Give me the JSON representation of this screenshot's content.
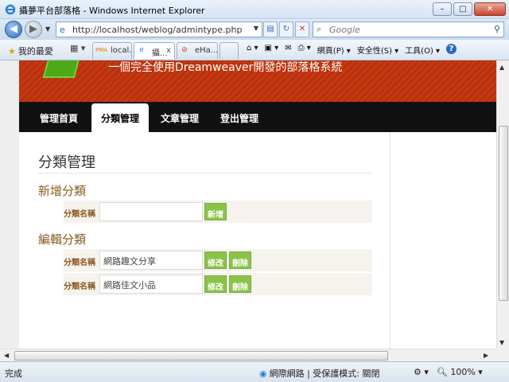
{
  "window": {
    "title": "攝夢平台部落格 - Windows Internet Explorer",
    "buttons": {
      "minimize": "–",
      "maximize": "□",
      "close": "✕"
    }
  },
  "address": {
    "url": "http://localhost/weblog/admintype.php",
    "search_placeholder": "Google"
  },
  "toolbar": {
    "favorites_label": "我的最愛",
    "tabs": [
      {
        "label": "local...",
        "icon": "pma-icon"
      },
      {
        "label": "攝...",
        "icon": "ie-page-icon",
        "close": "x"
      },
      {
        "label": "eHa...",
        "icon": "ehappy-icon"
      }
    ],
    "commands": [
      "網頁(P) ▾",
      "安全性(S) ▾",
      "工具(O) ▾",
      "?"
    ]
  },
  "site": {
    "slogan": "一個完全使用Dreamweaver開發的部落格系統",
    "nav": [
      {
        "label": "管理首頁",
        "active": false
      },
      {
        "label": "分類管理",
        "active": true
      },
      {
        "label": "文章管理",
        "active": false
      },
      {
        "label": "登出管理",
        "active": false
      }
    ],
    "accent_color": "#8bc34a",
    "heading_color": "#8a5a1e"
  },
  "content": {
    "page_title": "分類管理",
    "add_section": {
      "heading": "新增分類",
      "label": "分類名稱",
      "value": "",
      "button": "新增"
    },
    "edit_section": {
      "heading": "編輯分類",
      "rows": [
        {
          "label": "分類名稱",
          "value": "網路趣文分享",
          "edit": "修改",
          "delete": "刪除"
        },
        {
          "label": "分類名稱",
          "value": "網路佳文小品",
          "edit": "修改",
          "delete": "刪除"
        }
      ]
    }
  },
  "statusbar": {
    "status": "完成",
    "zone": "網際網路 | 受保護模式: 關閉",
    "zoom": "100%"
  }
}
